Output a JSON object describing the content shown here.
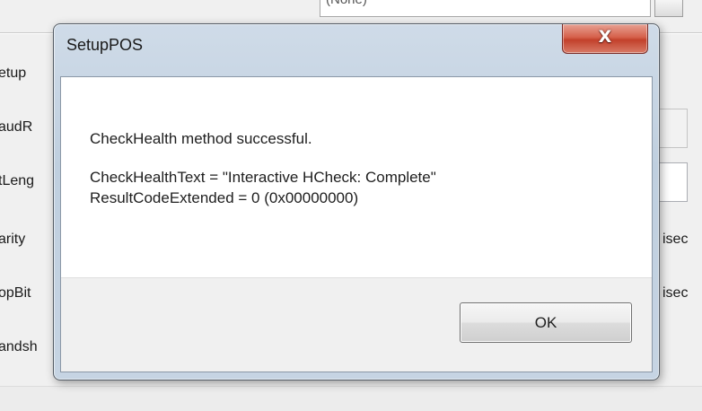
{
  "background": {
    "combo_value": "(None)",
    "labels": {
      "setup": "etup",
      "baud_rate": "audR",
      "bit_length": "tLeng",
      "parity": "arity",
      "stop_bits": "opBit",
      "handshake": "andsh"
    },
    "units": {
      "parity_unit": "isec",
      "stop_bits_unit": "isec"
    }
  },
  "dialog": {
    "title": "SetupPOS",
    "close_glyph": "X",
    "message": {
      "line1": "CheckHealth method successful.",
      "line2": "CheckHealthText = \"Interactive HCheck: Complete\"",
      "line3": "ResultCodeExtended = 0 (0x00000000)"
    },
    "ok_label": "OK"
  },
  "colors": {
    "close_button": "#c94a35",
    "dialog_frame": "#c6d4e3"
  }
}
